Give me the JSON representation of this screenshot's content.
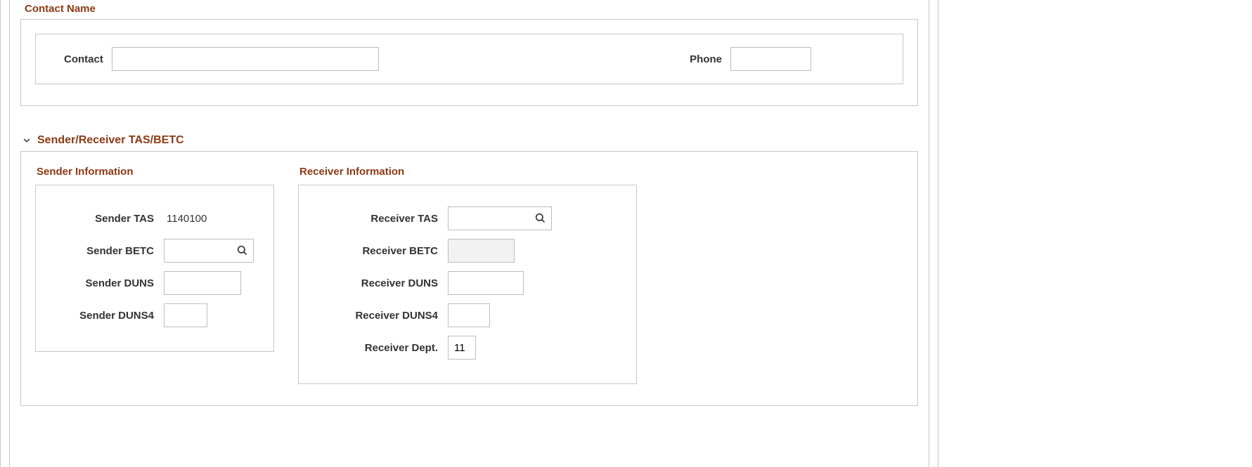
{
  "contact_section": {
    "title": "Contact Name",
    "contact_label": "Contact",
    "contact_value": "",
    "phone_label": "Phone",
    "phone_value": ""
  },
  "tasbetc_section": {
    "title": "Sender/Receiver TAS/BETC",
    "sender": {
      "title": "Sender Information",
      "tas_label": "Sender TAS",
      "tas_value": "1140100",
      "betc_label": "Sender BETC",
      "betc_value": "",
      "duns_label": "Sender DUNS",
      "duns_value": "",
      "duns4_label": "Sender DUNS4",
      "duns4_value": ""
    },
    "receiver": {
      "title": "Receiver Information",
      "tas_label": "Receiver TAS",
      "tas_value": "",
      "betc_label": "Receiver BETC",
      "betc_value": "",
      "duns_label": "Receiver DUNS",
      "duns_value": "",
      "duns4_label": "Receiver DUNS4",
      "duns4_value": "",
      "dept_label": "Receiver Dept.",
      "dept_value": "11"
    }
  }
}
